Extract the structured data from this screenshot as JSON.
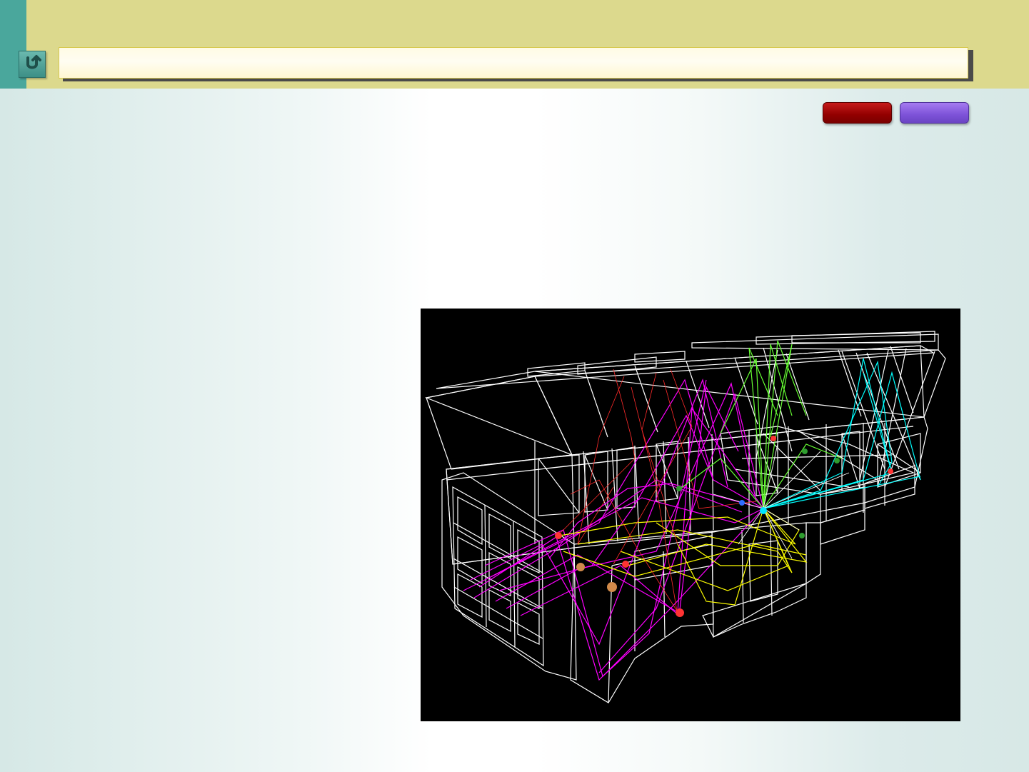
{
  "header": {
    "title": "",
    "back_icon": "return-arrow-icon"
  },
  "actions": {
    "primary_label": "",
    "secondary_label": "",
    "colors": {
      "primary": "#920000",
      "secondary": "#7d52d8"
    }
  },
  "figure": {
    "background": "#000000",
    "wire_color": "#ffffff",
    "ray_colors": [
      "#ff00ff",
      "#ffff00",
      "#00ffff",
      "#ff2a2a",
      "#66ff33"
    ],
    "node_colors": [
      "#ff3333",
      "#00e6ff",
      "#2f9d2f",
      "#2f6dff",
      "#d08a4a"
    ]
  }
}
